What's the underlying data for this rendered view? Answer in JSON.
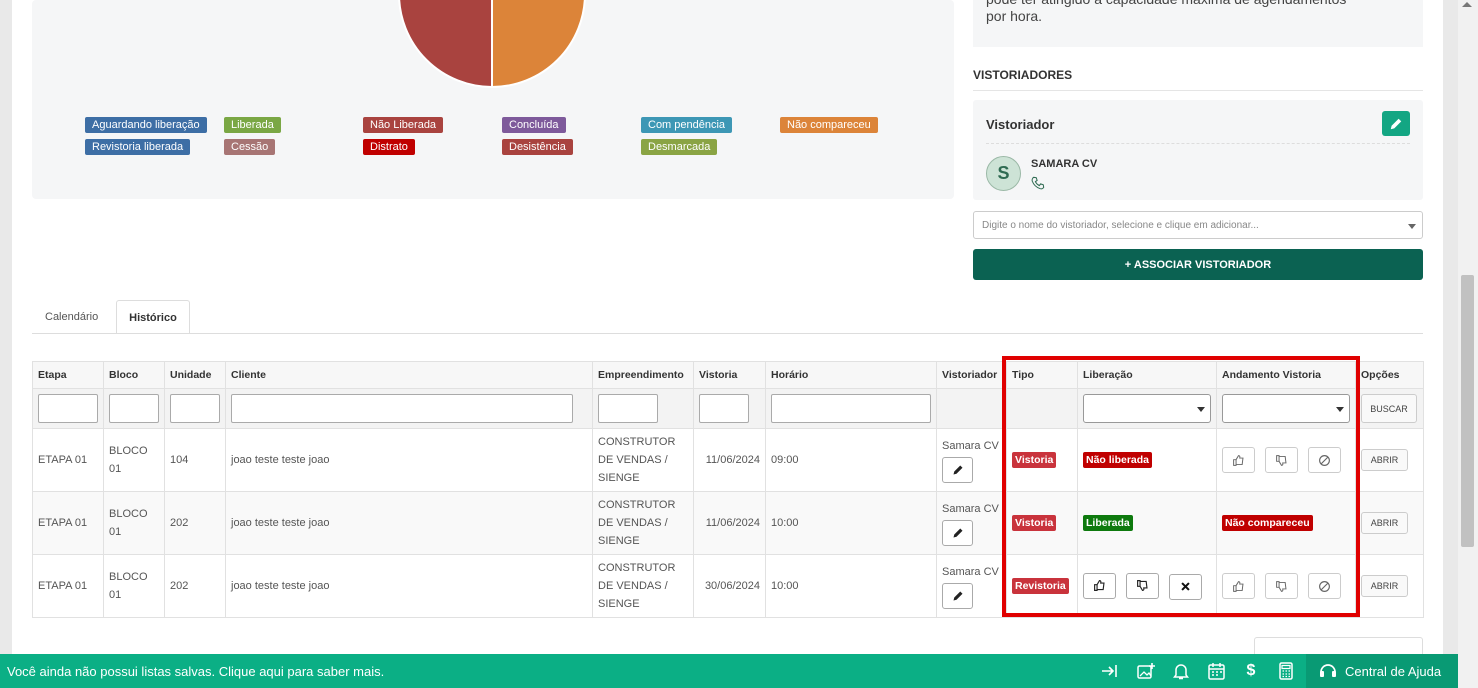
{
  "info_text": {
    "line1": "pode ter atingido a capacidade máxima de agendamentos",
    "line2": "por hora."
  },
  "legend": [
    {
      "label": "Aguardando liberação",
      "color": "#3d6ea5"
    },
    {
      "label": "Liberada",
      "color": "#7aa744"
    },
    {
      "label": "Não Liberada",
      "color": "#a9433f"
    },
    {
      "label": "Concluída",
      "color": "#7e5a9b"
    },
    {
      "label": "Com pendência",
      "color": "#3d97b5"
    },
    {
      "label": "Não compareceu",
      "color": "#dc8439"
    },
    {
      "label": "Revistoria liberada",
      "color": "#3d6ea5"
    },
    {
      "label": "Cessão",
      "color": "#a77574"
    },
    {
      "label": "Distrato",
      "color": "#c00000"
    },
    {
      "label": "Desistência",
      "color": "#a9433f"
    },
    {
      "label": "Desmarcada",
      "color": "#8aa444"
    }
  ],
  "chart_data": {
    "type": "pie",
    "categories": [
      "Não compareceu",
      "Não Liberada"
    ],
    "values": [
      50,
      50
    ],
    "colors": [
      "#dc8439",
      "#a9433f"
    ]
  },
  "vistoriadores": {
    "section_title": "VISTORIADORES",
    "card_title": "Vistoriador",
    "avatar_letter": "S",
    "name": "SAMARA CV",
    "select_placeholder": "Digite o nome do vistoriador, selecione e clique em adicionar...",
    "assoc_button": "+ ASSOCIAR VISTORIADOR"
  },
  "tabs": {
    "calendario": "Calendário",
    "historico": "Histórico"
  },
  "table": {
    "headers": [
      "Etapa",
      "Bloco",
      "Unidade",
      "Cliente",
      "Empreendimento",
      "Vistoria",
      "Horário",
      "Vistoriador",
      "Tipo",
      "Liberação",
      "Andamento Vistoria",
      "Opções"
    ],
    "buscar": "BUSCAR",
    "abrir": "ABRIR",
    "rows": [
      {
        "etapa": "ETAPA 01",
        "bloco": "BLOCO 01",
        "unidade": "104",
        "cliente": "joao teste teste joao",
        "emp": "CONSTRUTOR DE VENDAS / SIENGE",
        "vistoria": "11/06/2024",
        "horario": "09:00",
        "vistoriador": "Samara CV",
        "tipo": "Vistoria",
        "liberacao": "Não liberada",
        "andamento": ""
      },
      {
        "etapa": "ETAPA 01",
        "bloco": "BLOCO 01",
        "unidade": "202",
        "cliente": "joao teste teste joao",
        "emp": "CONSTRUTOR DE VENDAS / SIENGE",
        "vistoria": "11/06/2024",
        "horario": "10:00",
        "vistoriador": "Samara CV",
        "tipo": "Vistoria",
        "liberacao": "Liberada",
        "andamento": "Não compareceu"
      },
      {
        "etapa": "ETAPA 01",
        "bloco": "BLOCO 01",
        "unidade": "202",
        "cliente": "joao teste teste joao",
        "emp": "CONSTRUTOR DE VENDAS / SIENGE",
        "vistoria": "30/06/2024",
        "horario": "10:00",
        "vistoriador": "Samara CV",
        "tipo": "Revistoria",
        "liberacao": "",
        "andamento": ""
      }
    ]
  },
  "colors": {
    "tag_red": "#c9333c",
    "tag_deepred": "#c00000",
    "tag_green": "#0e7a0e"
  },
  "footer": {
    "message": "Você ainda não possui listas salvas. Clique aqui para saber mais.",
    "help": "Central de Ajuda"
  }
}
